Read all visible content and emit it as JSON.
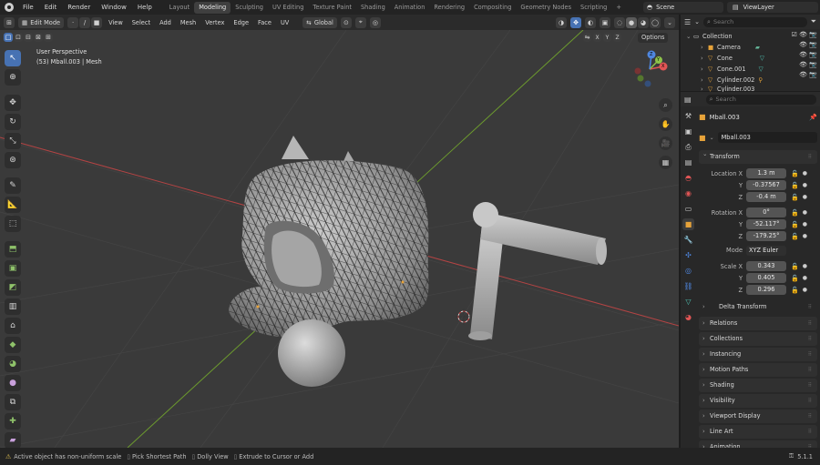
{
  "topbar": {
    "menus": [
      "File",
      "Edit",
      "Render",
      "Window",
      "Help"
    ],
    "workspaces": [
      "Layout",
      "Modeling",
      "Sculpting",
      "UV Editing",
      "Texture Paint",
      "Shading",
      "Animation",
      "Rendering",
      "Compositing",
      "Geometry Nodes",
      "Scripting"
    ],
    "active_workspace": "Modeling",
    "add_tab": "+",
    "scene": "Scene",
    "view_layer": "ViewLayer"
  },
  "viewport_header": {
    "mode": "Edit Mode",
    "menus": [
      "View",
      "Select",
      "Add",
      "Mesh",
      "Vertex",
      "Edge",
      "Face",
      "UV"
    ],
    "transform_orientation": "Global",
    "axes": [
      "X",
      "Y",
      "Z"
    ],
    "options": "Options"
  },
  "viewport": {
    "perspective": "User Perspective",
    "object_info": "(53) Mball.003 | Mesh",
    "gizmo": {
      "x": "X",
      "y": "Y",
      "z": "Z"
    }
  },
  "outliner": {
    "search_placeholder": "Search",
    "collection": "Collection",
    "items": [
      "Camera",
      "Cone",
      "Cone.001",
      "Cylinder.002",
      "Cylinder.003"
    ]
  },
  "properties": {
    "search_placeholder": "Search",
    "object_name": "Mball.003",
    "mesh_name": "Mball.003",
    "transform_title": "Transform",
    "location_label": "Location X",
    "location": [
      "1.3 m",
      "-0.37567",
      "-0.4 m"
    ],
    "rotation_label": "Rotation X",
    "rotation": [
      "0°",
      "-52.117°",
      "-179.25°"
    ],
    "mode_label": "Mode",
    "mode_value": "XYZ Euler",
    "scale_label": "Scale X",
    "scale": [
      "0.343",
      "0.405",
      "0.296"
    ],
    "y_label": "Y",
    "z_label": "Z",
    "delta_transform": "Delta Transform",
    "panels": [
      "Relations",
      "Collections",
      "Instancing",
      "Motion Paths",
      "Shading",
      "Visibility",
      "Viewport Display",
      "Line Art",
      "Animation"
    ]
  },
  "statusbar": {
    "message": "Active object has non-uniform scale",
    "hint1": "Pick Shortest Path",
    "hint2": "Dolly View",
    "hint3": "Extrude to Cursor or Add",
    "version": "5.1.1"
  },
  "colors": {
    "accent": "#4772b3",
    "viewport_bg": "#3a3a3a",
    "grid_x": "#b34444",
    "grid_y": "#6c9a2e",
    "orange": "#e7a33a"
  }
}
